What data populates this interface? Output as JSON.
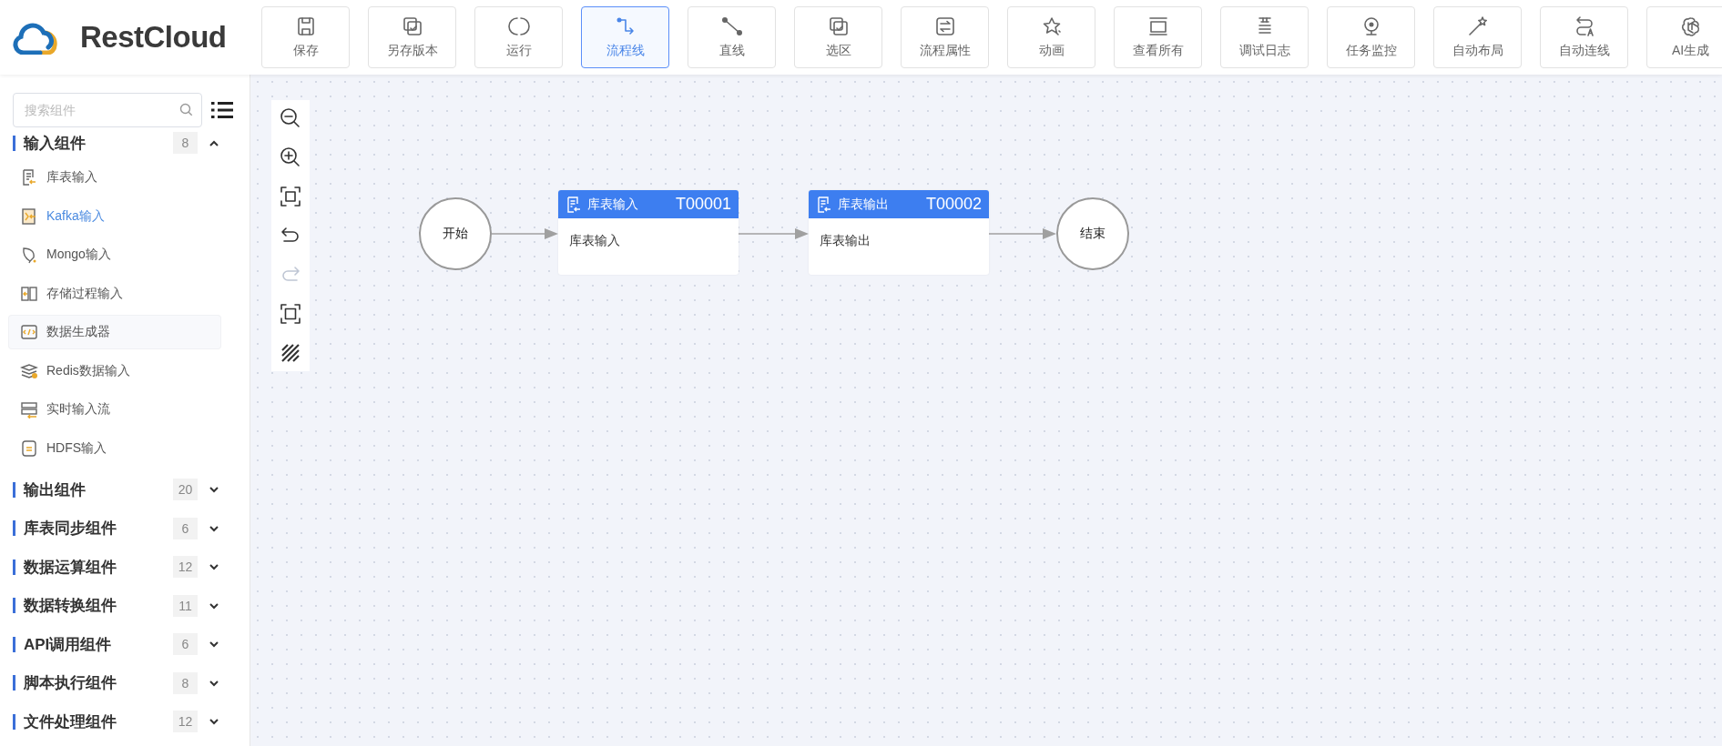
{
  "app": {
    "logo": "RestCloud"
  },
  "toolbar": [
    {
      "label": "保存",
      "selected": false
    },
    {
      "label": "另存版本",
      "selected": false
    },
    {
      "label": "运行",
      "selected": false
    },
    {
      "label": "流程线",
      "selected": true
    },
    {
      "label": "直线",
      "selected": false
    },
    {
      "label": "选区",
      "selected": false
    },
    {
      "label": "流程属性",
      "selected": false
    },
    {
      "label": "动画",
      "selected": false
    },
    {
      "label": "查看所有",
      "selected": false
    },
    {
      "label": "调试日志",
      "selected": false
    },
    {
      "label": "任务监控",
      "selected": false
    },
    {
      "label": "自动布局",
      "selected": false
    },
    {
      "label": "自动连线",
      "selected": false
    },
    {
      "label": "AI生成",
      "selected": false
    }
  ],
  "sidebar": {
    "search": {
      "placeholder": "搜索组件"
    },
    "groups": [
      {
        "title": "输入组件",
        "count": "8",
        "expanded": true,
        "items": [
          {
            "label": "库表输入",
            "selected": false,
            "hovered": false
          },
          {
            "label": "Kafka输入",
            "selected": true,
            "hovered": false
          },
          {
            "label": "Mongo输入",
            "selected": false,
            "hovered": false
          },
          {
            "label": "存储过程输入",
            "selected": false,
            "hovered": false
          },
          {
            "label": "数据生成器",
            "selected": false,
            "hovered": true
          },
          {
            "label": "Redis数据输入",
            "selected": false,
            "hovered": false
          },
          {
            "label": "实时输入流",
            "selected": false,
            "hovered": false
          },
          {
            "label": "HDFS输入",
            "selected": false,
            "hovered": false
          }
        ]
      },
      {
        "title": "输出组件",
        "count": "20",
        "expanded": false
      },
      {
        "title": "库表同步组件",
        "count": "6",
        "expanded": false
      },
      {
        "title": "数据运算组件",
        "count": "12",
        "expanded": false
      },
      {
        "title": "数据转换组件",
        "count": "11",
        "expanded": false
      },
      {
        "title": "API调用组件",
        "count": "6",
        "expanded": false
      },
      {
        "title": "脚本执行组件",
        "count": "8",
        "expanded": false
      },
      {
        "title": "文件处理组件",
        "count": "12",
        "expanded": false
      }
    ]
  },
  "canvas_tools": [
    {
      "kind": "zoom-out",
      "disabled": false
    },
    {
      "kind": "zoom-in",
      "disabled": false
    },
    {
      "kind": "fit",
      "disabled": false
    },
    {
      "kind": "undo",
      "disabled": false
    },
    {
      "kind": "redo",
      "disabled": true
    },
    {
      "kind": "fullscreen",
      "disabled": false
    },
    {
      "kind": "grid",
      "disabled": false
    }
  ],
  "canvas": {
    "nodes": [
      {
        "kind": "start",
        "label": "开始"
      },
      {
        "kind": "task",
        "title": "库表输入",
        "code": "T00001",
        "body": "库表输入"
      },
      {
        "kind": "task",
        "title": "库表输出",
        "code": "T00002",
        "body": "库表输出"
      },
      {
        "kind": "end",
        "label": "结束"
      }
    ]
  }
}
